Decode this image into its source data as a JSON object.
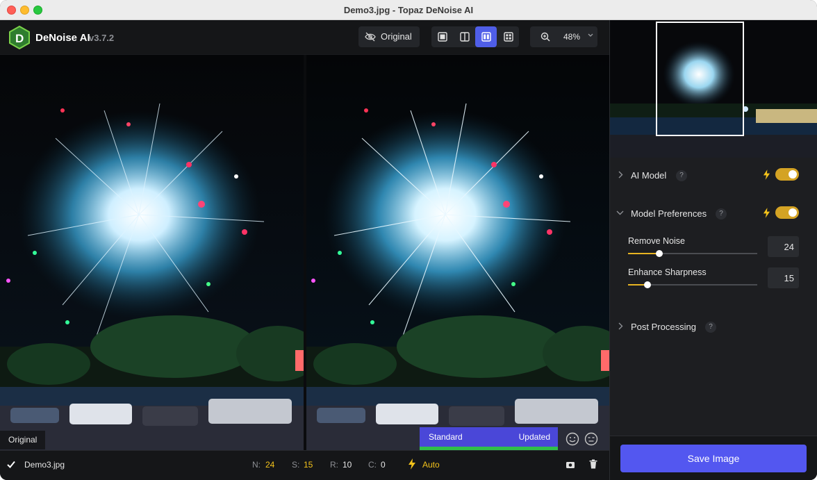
{
  "window": {
    "title": "Demo3.jpg - Topaz DeNoise AI"
  },
  "app": {
    "name": "DeNoise AI",
    "version": "v3.7.2"
  },
  "toolbar": {
    "original_label": "Original",
    "view_modes": [
      "single-view",
      "split-view",
      "side-by-side-view",
      "comparison-grid-view"
    ],
    "active_view": "side-by-side-view",
    "zoom": "48%"
  },
  "preview": {
    "left_label": "Original",
    "model_name": "Standard",
    "model_status": "Updated"
  },
  "status": {
    "filename": "Demo3.jpg",
    "n_label": "N:",
    "n_value": "24",
    "s_label": "S:",
    "s_value": "15",
    "r_label": "R:",
    "r_value": "10",
    "c_label": "C:",
    "c_value": "0",
    "mode": "Auto"
  },
  "sidebar": {
    "ai_model": {
      "label": "AI Model",
      "help": "?",
      "enabled": true
    },
    "model_preferences": {
      "label": "Model Preferences",
      "help": "?",
      "enabled": true
    },
    "remove_noise": {
      "label": "Remove Noise",
      "value": "24",
      "fraction": 0.24
    },
    "enhance_sharpness": {
      "label": "Enhance Sharpness",
      "value": "15",
      "fraction": 0.15
    },
    "post_processing": {
      "label": "Post Processing",
      "help": "?"
    },
    "save_label": "Save Image"
  },
  "colors": {
    "accent": "#5357f0",
    "toggle_on": "#d4a324",
    "slider_fill": "#e8b422",
    "status_value": "#f3c21b",
    "updated_bar": "#2fbf4a"
  }
}
